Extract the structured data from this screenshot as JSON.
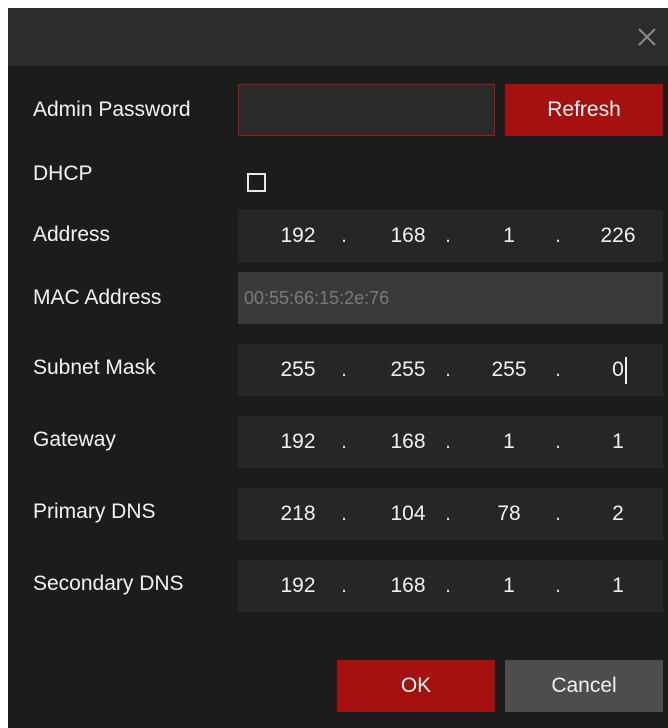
{
  "dialog": {
    "close_icon": "close-icon"
  },
  "admin_password": {
    "label": "Admin Password",
    "value": "",
    "refresh_label": "Refresh"
  },
  "dhcp": {
    "label": "DHCP",
    "checked": false
  },
  "address": {
    "label": "Address",
    "octets": [
      "192",
      "168",
      "1",
      "226"
    ]
  },
  "mac_address": {
    "label": "MAC Address",
    "value": "00:55:66:15:2e:76"
  },
  "subnet_mask": {
    "label": "Subnet Mask",
    "octets": [
      "255",
      "255",
      "255",
      "0"
    ]
  },
  "gateway": {
    "label": "Gateway",
    "octets": [
      "192",
      "168",
      "1",
      "1"
    ]
  },
  "primary_dns": {
    "label": "Primary DNS",
    "octets": [
      "218",
      "104",
      "78",
      "2"
    ]
  },
  "secondary_dns": {
    "label": "Secondary DNS",
    "octets": [
      "192",
      "168",
      "1",
      "1"
    ]
  },
  "footer": {
    "ok_label": "OK",
    "cancel_label": "Cancel"
  },
  "colors": {
    "accent": "#a51111",
    "background": "#1c1c1c",
    "titlebar": "#2c2c2c",
    "field": "#262626"
  }
}
